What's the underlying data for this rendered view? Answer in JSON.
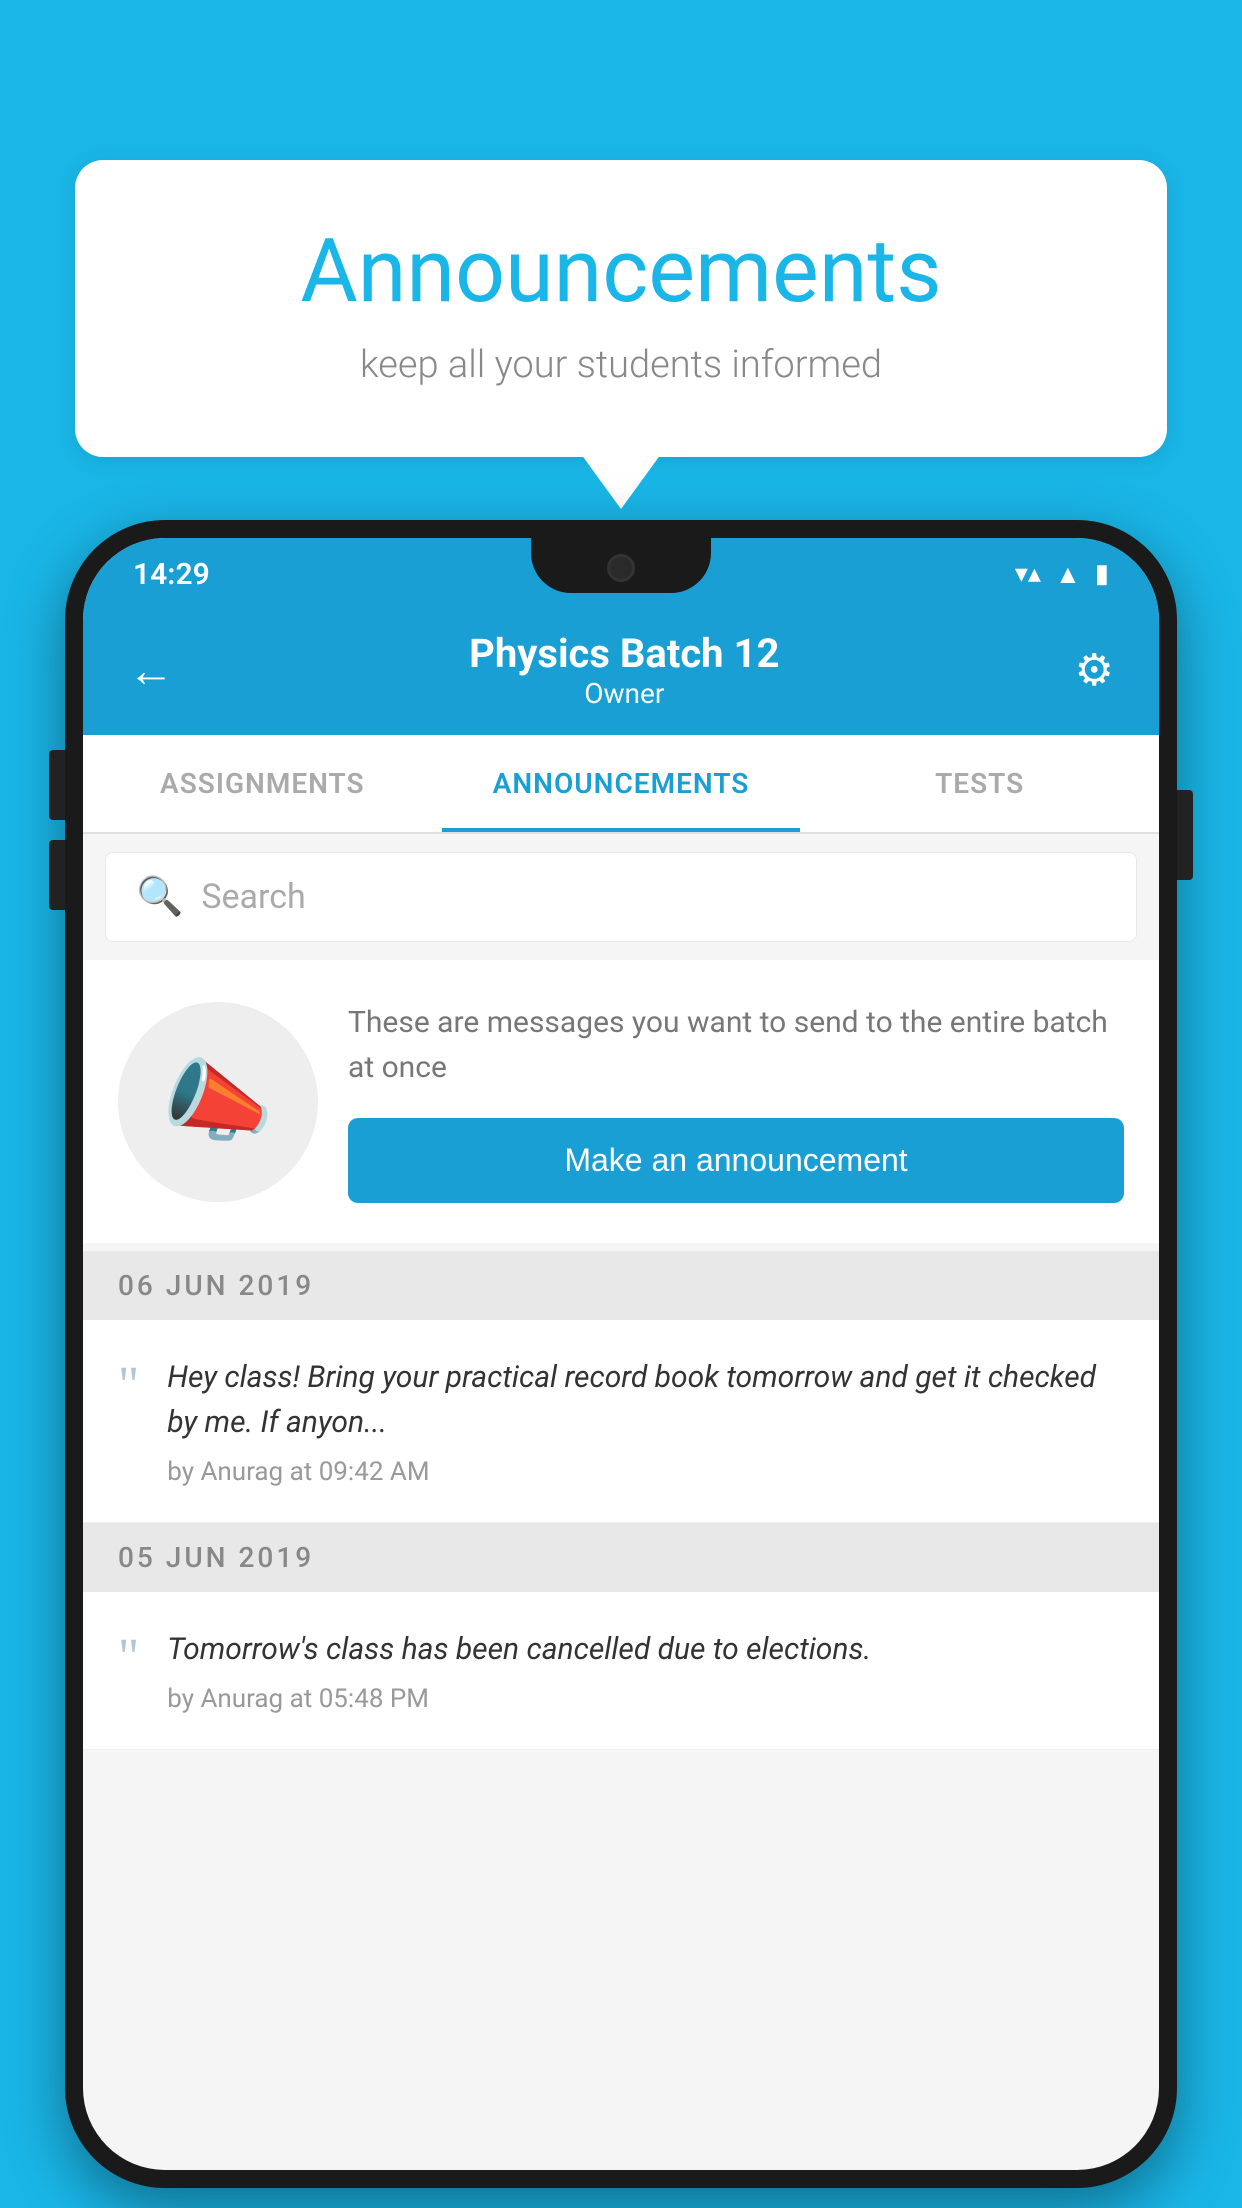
{
  "background_color": "#1ab6e8",
  "speech_bubble": {
    "title": "Announcements",
    "subtitle": "keep all your students informed"
  },
  "phone": {
    "status_bar": {
      "time": "14:29",
      "signal_icon": "▲",
      "wifi_icon": "▼",
      "battery_icon": "▮"
    },
    "app_bar": {
      "back_label": "←",
      "title": "Physics Batch 12",
      "subtitle": "Owner",
      "gear_label": "⚙"
    },
    "tabs": [
      {
        "label": "ASSIGNMENTS",
        "active": false
      },
      {
        "label": "ANNOUNCEMENTS",
        "active": true
      },
      {
        "label": "TESTS",
        "active": false
      }
    ],
    "search": {
      "placeholder": "Search"
    },
    "cta_section": {
      "description": "These are messages you want to send to the entire batch at once",
      "button_label": "Make an announcement"
    },
    "announcements": [
      {
        "date": "06  JUN  2019",
        "text": "Hey class! Bring your practical record book tomorrow and get it checked by me. If anyon...",
        "meta": "by Anurag at 09:42 AM"
      },
      {
        "date": "05  JUN  2019",
        "text": "Tomorrow's class has been cancelled due to elections.",
        "meta": "by Anurag at 05:48 PM"
      }
    ]
  }
}
